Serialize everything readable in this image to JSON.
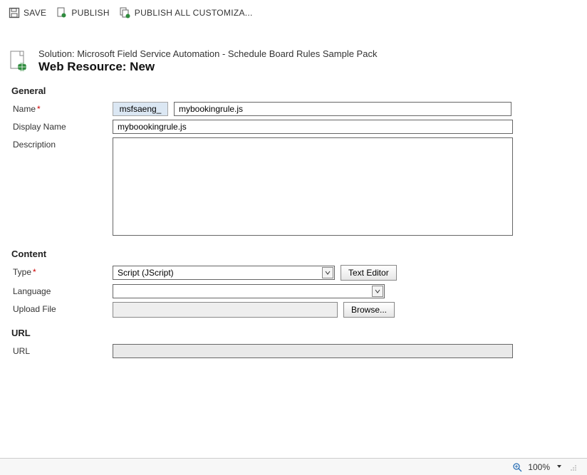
{
  "toolbar": {
    "save": "SAVE",
    "publish": "PUBLISH",
    "publish_all": "PUBLISH ALL CUSTOMIZA..."
  },
  "header": {
    "breadcrumb": "Solution: Microsoft Field Service Automation - Schedule Board Rules Sample Pack",
    "title": "Web Resource: New"
  },
  "sections": {
    "general": "General",
    "content": "Content",
    "url": "URL"
  },
  "labels": {
    "name": "Name",
    "display_name": "Display Name",
    "description": "Description",
    "type": "Type",
    "language": "Language",
    "upload_file": "Upload File",
    "url": "URL"
  },
  "fields": {
    "prefix": "msfsaeng_",
    "name": "mybookingrule.js",
    "display_name": "myboookingrule.js",
    "description": "",
    "type_selected": "Script (JScript)",
    "language_selected": "",
    "upload_file_path": "",
    "url_value": ""
  },
  "buttons": {
    "text_editor": "Text Editor",
    "browse": "Browse..."
  },
  "status": {
    "zoom": "100%"
  }
}
